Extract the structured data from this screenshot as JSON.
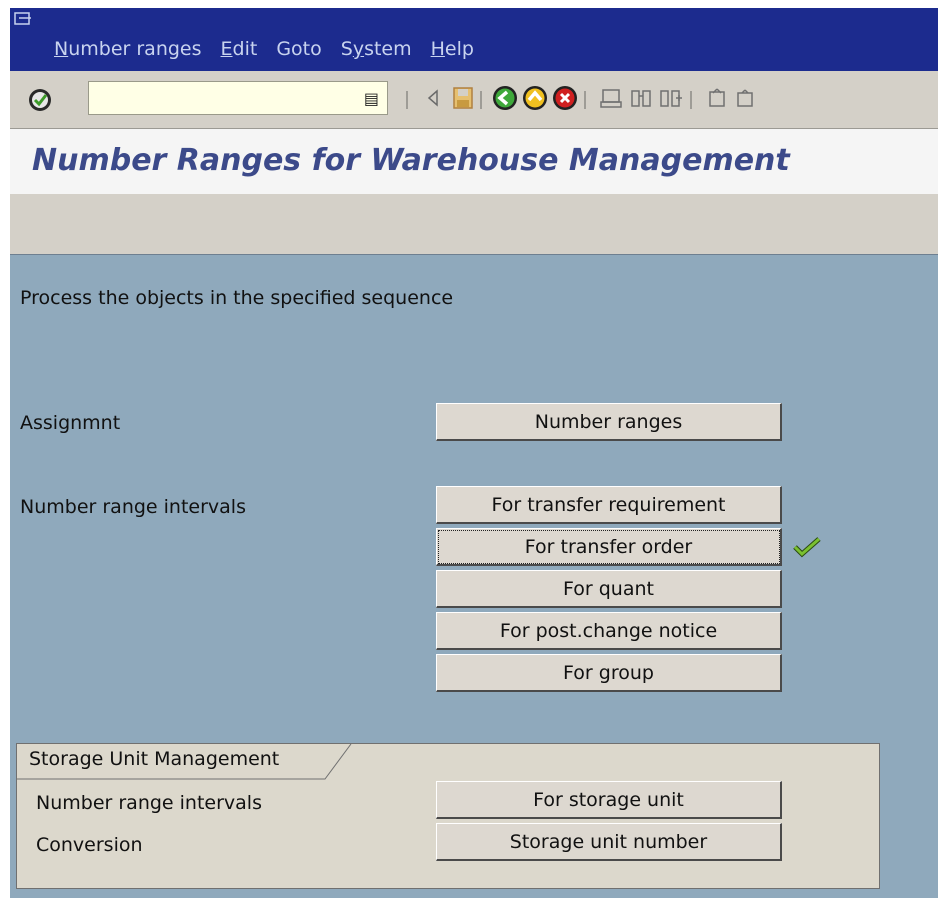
{
  "menu": {
    "items": [
      {
        "label": "Number ranges",
        "mnemonic": "N"
      },
      {
        "label": "Edit",
        "mnemonic": "E"
      },
      {
        "label": "Goto",
        "mnemonic": ""
      },
      {
        "label": "System",
        "mnemonic": "y"
      },
      {
        "label": "Help",
        "mnemonic": "H"
      }
    ]
  },
  "toolbar": {
    "command_value": "",
    "icons": [
      "enter-icon",
      "back-arrow-icon",
      "save-icon",
      "back-icon",
      "exit-icon",
      "cancel-icon",
      "print-icon",
      "find-icon",
      "find-next-icon",
      "first-page-icon",
      "previous-page-icon"
    ]
  },
  "title": "Number Ranges for Warehouse Management",
  "content": {
    "instruction": "Process the objects in the specified sequence",
    "assignment_label": "Assignmnt",
    "assignment_button": "Number ranges",
    "intervals_label": "Number range intervals",
    "interval_buttons": [
      "For transfer requirement",
      "For transfer order",
      "For quant",
      "For post.change notice",
      "For group"
    ]
  },
  "frame": {
    "title": "Storage Unit Management",
    "row1_label": "Number range intervals",
    "row1_button": "For storage unit",
    "row2_label": "Conversion",
    "row2_button": "Storage unit number"
  },
  "colors": {
    "menubar": "#1c2b8e",
    "background": "#8fa9bc",
    "title": "#3c4a8a",
    "check": "#5ba020"
  }
}
